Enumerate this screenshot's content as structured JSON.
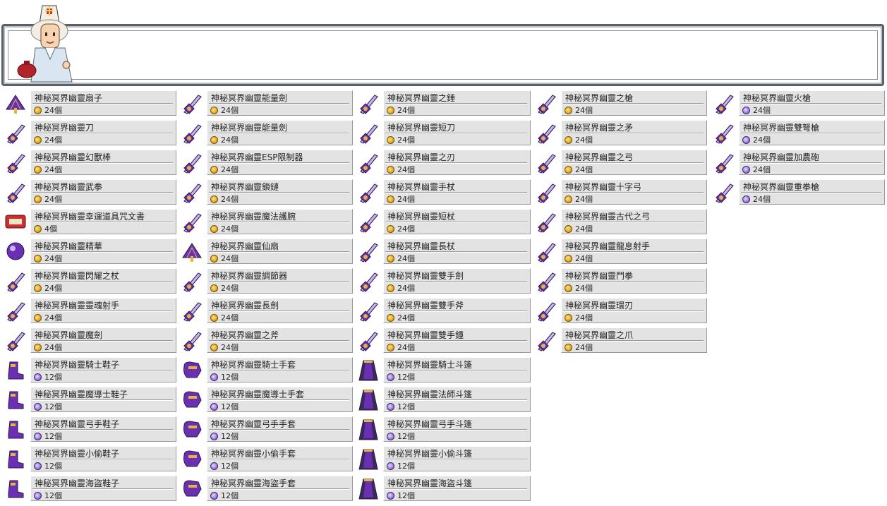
{
  "npc": {
    "name_hidden": ""
  },
  "colors": {
    "panel_bg": "#e3e3e3",
    "frame_border": "#4a4f55",
    "item_accent": "#6b2fb3"
  },
  "columns": [
    {
      "items": [
        {
          "name": "神秘冥界幽靈扇子",
          "qty": "24個",
          "coin": "gold",
          "icon": "fan-icon"
        },
        {
          "name": "神秘冥界幽靈刀",
          "qty": "24個",
          "coin": "gold",
          "icon": "katana-icon"
        },
        {
          "name": "神秘冥界幽靈幻獸棒",
          "qty": "24個",
          "coin": "gold",
          "icon": "staff-icon"
        },
        {
          "name": "神秘冥界幽靈武拳",
          "qty": "24個",
          "coin": "gold",
          "icon": "knuckle-icon"
        },
        {
          "name": "神秘冥界幽靈幸運道具咒文書",
          "qty": "4個",
          "coin": "gold",
          "icon": "scroll-icon"
        },
        {
          "name": "神秘冥界幽靈精華",
          "qty": "24個",
          "coin": "gold",
          "icon": "orb-icon"
        },
        {
          "name": "神秘冥界幽靈閃耀之杖",
          "qty": "24個",
          "coin": "gold",
          "icon": "wand-icon"
        },
        {
          "name": "神秘冥界幽靈靈魂射手",
          "qty": "24個",
          "coin": "gold",
          "icon": "soul-shooter-icon"
        },
        {
          "name": "神秘冥界幽靈魔劍",
          "qty": "24個",
          "coin": "gold",
          "icon": "sword-icon"
        },
        {
          "name": "神秘冥界幽靈騎士鞋子",
          "qty": "12個",
          "coin": "purple",
          "icon": "shoe-icon"
        },
        {
          "name": "神秘冥界幽靈魔導士鞋子",
          "qty": "12個",
          "coin": "purple",
          "icon": "shoe-icon"
        },
        {
          "name": "神秘冥界幽靈弓手鞋子",
          "qty": "12個",
          "coin": "purple",
          "icon": "shoe-icon"
        },
        {
          "name": "神秘冥界幽靈小偷鞋子",
          "qty": "12個",
          "coin": "purple",
          "icon": "shoe-icon"
        },
        {
          "name": "神秘冥界幽靈海盜鞋子",
          "qty": "12個",
          "coin": "purple",
          "icon": "shoe-icon"
        }
      ]
    },
    {
      "items": [
        {
          "name": "神秘冥界幽靈能量劍",
          "qty": "24個",
          "coin": "gold",
          "icon": "energy-sword-icon"
        },
        {
          "name": "神秘冥界幽靈能量劍",
          "qty": "24個",
          "coin": "gold",
          "icon": "energy-sword-icon"
        },
        {
          "name": "神秘冥界幽靈ESP限制器",
          "qty": "24個",
          "coin": "gold",
          "icon": "esp-limiter-icon"
        },
        {
          "name": "神秘冥界幽靈鎖鏈",
          "qty": "24個",
          "coin": "gold",
          "icon": "chain-icon"
        },
        {
          "name": "神秘冥界幽靈魔法護腕",
          "qty": "24個",
          "coin": "gold",
          "icon": "gauntlet-icon"
        },
        {
          "name": "神秘冥界幽靈仙扇",
          "qty": "24個",
          "coin": "gold",
          "icon": "fan-icon"
        },
        {
          "name": "神秘冥界幽靈調節器",
          "qty": "24個",
          "coin": "gold",
          "icon": "controller-icon"
        },
        {
          "name": "神秘冥界幽靈長劍",
          "qty": "24個",
          "coin": "gold",
          "icon": "sword-icon"
        },
        {
          "name": "神秘冥界幽靈之斧",
          "qty": "24個",
          "coin": "gold",
          "icon": "axe-icon"
        },
        {
          "name": "神秘冥界幽靈騎士手套",
          "qty": "12個",
          "coin": "purple",
          "icon": "glove-icon"
        },
        {
          "name": "神秘冥界幽靈魔導士手套",
          "qty": "12個",
          "coin": "purple",
          "icon": "glove-icon"
        },
        {
          "name": "神秘冥界幽靈弓手手套",
          "qty": "12個",
          "coin": "purple",
          "icon": "glove-icon"
        },
        {
          "name": "神秘冥界幽靈小偷手套",
          "qty": "12個",
          "coin": "purple",
          "icon": "glove-icon"
        },
        {
          "name": "神秘冥界幽靈海盜手套",
          "qty": "12個",
          "coin": "purple",
          "icon": "glove-icon"
        }
      ]
    },
    {
      "items": [
        {
          "name": "神秘冥界幽靈之錘",
          "qty": "24個",
          "coin": "gold",
          "icon": "hammer-icon"
        },
        {
          "name": "神秘冥界幽靈短刀",
          "qty": "24個",
          "coin": "gold",
          "icon": "dagger-icon"
        },
        {
          "name": "神秘冥界幽靈之刃",
          "qty": "24個",
          "coin": "gold",
          "icon": "blade-icon"
        },
        {
          "name": "神秘冥界幽靈手杖",
          "qty": "24個",
          "coin": "gold",
          "icon": "cane-icon"
        },
        {
          "name": "神秘冥界幽靈短杖",
          "qty": "24個",
          "coin": "gold",
          "icon": "wand-icon"
        },
        {
          "name": "神秘冥界幽靈長杖",
          "qty": "24個",
          "coin": "gold",
          "icon": "staff-icon"
        },
        {
          "name": "神秘冥界幽靈雙手劍",
          "qty": "24個",
          "coin": "gold",
          "icon": "two-handed-sword-icon"
        },
        {
          "name": "神秘冥界幽靈雙手斧",
          "qty": "24個",
          "coin": "gold",
          "icon": "two-handed-axe-icon"
        },
        {
          "name": "神秘冥界幽靈雙手鍾",
          "qty": "24個",
          "coin": "gold",
          "icon": "two-handed-hammer-icon"
        },
        {
          "name": "神秘冥界幽靈騎士斗篷",
          "qty": "12個",
          "coin": "purple",
          "icon": "cape-icon"
        },
        {
          "name": "神秘冥界幽靈法師斗篷",
          "qty": "12個",
          "coin": "purple",
          "icon": "cape-icon"
        },
        {
          "name": "神秘冥界幽靈弓手斗篷",
          "qty": "12個",
          "coin": "purple",
          "icon": "cape-icon"
        },
        {
          "name": "神秘冥界幽靈小偷斗篷",
          "qty": "12個",
          "coin": "purple",
          "icon": "cape-icon"
        },
        {
          "name": "神秘冥界幽靈海盜斗篷",
          "qty": "12個",
          "coin": "purple",
          "icon": "cape-icon"
        }
      ]
    },
    {
      "items": [
        {
          "name": "神秘冥界幽靈之槍",
          "qty": "24個",
          "coin": "gold",
          "icon": "spear-icon"
        },
        {
          "name": "神秘冥界幽靈之矛",
          "qty": "24個",
          "coin": "gold",
          "icon": "polearm-icon"
        },
        {
          "name": "神秘冥界幽靈之弓",
          "qty": "24個",
          "coin": "gold",
          "icon": "bow-icon"
        },
        {
          "name": "神秘冥界幽靈十字弓",
          "qty": "24個",
          "coin": "gold",
          "icon": "crossbow-icon"
        },
        {
          "name": "神秘冥界幽靈古代之弓",
          "qty": "24個",
          "coin": "gold",
          "icon": "ancient-bow-icon"
        },
        {
          "name": "神秘冥界幽靈龍息射手",
          "qty": "24個",
          "coin": "gold",
          "icon": "dual-bowgun-icon"
        },
        {
          "name": "神秘冥界幽靈鬥拳",
          "qty": "24個",
          "coin": "gold",
          "icon": "knuckle-icon"
        },
        {
          "name": "神秘冥界幽靈環刃",
          "qty": "24個",
          "coin": "gold",
          "icon": "chakram-icon"
        },
        {
          "name": "神秘冥界幽靈之爪",
          "qty": "24個",
          "coin": "gold",
          "icon": "claw-icon"
        }
      ]
    },
    {
      "items": [
        {
          "name": "神秘冥界幽靈火槍",
          "qty": "24個",
          "coin": "purple",
          "icon": "gun-icon"
        },
        {
          "name": "神秘冥界幽靈雙弩槍",
          "qty": "24個",
          "coin": "purple",
          "icon": "dual-crossbow-icon"
        },
        {
          "name": "神秘冥界幽靈加農砲",
          "qty": "24個",
          "coin": "purple",
          "icon": "cannon-icon"
        },
        {
          "name": "神秘冥界幽靈重拳槍",
          "qty": "24個",
          "coin": "purple",
          "icon": "arm-cannon-icon"
        }
      ]
    }
  ]
}
